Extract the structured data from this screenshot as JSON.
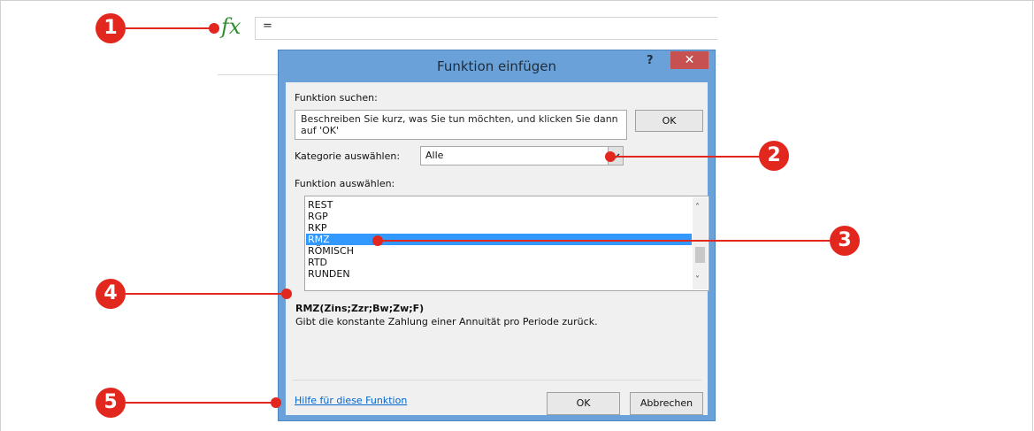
{
  "formula_bar": {
    "fx_label": "fx",
    "value": "="
  },
  "dialog": {
    "title": "Funktion einfügen",
    "help_label": "?",
    "close_label": "✕",
    "search_label": "Funktion suchen:",
    "search_text": "Beschreiben Sie kurz, was Sie tun möchten, und klicken Sie dann auf 'OK'",
    "search_ok_label": "OK",
    "category_label": "Kategorie auswählen:",
    "category_value": "Alle",
    "function_list_label": "Funktion auswählen:",
    "functions": [
      "REST",
      "RGP",
      "RKP",
      "RMZ",
      "RÖMISCH",
      "RTD",
      "RUNDEN"
    ],
    "selected_function": "RMZ",
    "syntax": "RMZ(Zins;Zzr;Bw;Zw;F)",
    "description": "Gibt die konstante Zahlung einer Annuität pro Periode zurück.",
    "help_link": "Hilfe für diese Funktion",
    "ok_label": "OK",
    "cancel_label": "Abbrechen"
  },
  "callouts": [
    "1",
    "2",
    "3",
    "4",
    "5"
  ],
  "colors": {
    "callout": "#e2281e",
    "selection": "#3399ff",
    "dialog_frame": "#6aa1d8",
    "close_button": "#c75050",
    "link": "#0066cc",
    "fx": "#2f8f2f"
  }
}
